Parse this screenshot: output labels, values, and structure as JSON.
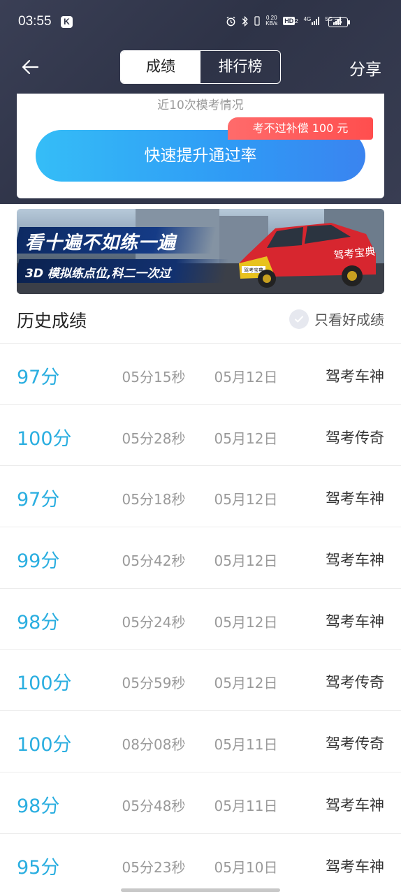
{
  "statusbar": {
    "time": "03:55",
    "k_badge": "K",
    "net_speed_value": "0.20",
    "net_speed_unit": "KB/s",
    "hd_label": "HD",
    "hd_sub": "2",
    "net1": "4G",
    "net2": "5G",
    "battery": "35"
  },
  "nav": {
    "tab_active": "成绩",
    "tab_inactive": "排行榜",
    "share_label": "分享"
  },
  "card": {
    "subtitle": "近10次模考情况",
    "cta_label": "快速提升通过率",
    "promo_label": "考不过补偿 100 元"
  },
  "banner": {
    "headline": "看十遍不如练一遍",
    "subline": "3D 模拟练点位,科二一次过",
    "car_text": "驾考宝典",
    "plate_text": "驾考宝典"
  },
  "history": {
    "title": "历史成绩",
    "filter_label": "只看好成绩",
    "rows": [
      {
        "score": "97分",
        "duration": "05分15秒",
        "date": "05月12日",
        "rank": "驾考车神"
      },
      {
        "score": "100分",
        "duration": "05分28秒",
        "date": "05月12日",
        "rank": "驾考传奇"
      },
      {
        "score": "97分",
        "duration": "05分18秒",
        "date": "05月12日",
        "rank": "驾考车神"
      },
      {
        "score": "99分",
        "duration": "05分42秒",
        "date": "05月12日",
        "rank": "驾考车神"
      },
      {
        "score": "98分",
        "duration": "05分24秒",
        "date": "05月12日",
        "rank": "驾考车神"
      },
      {
        "score": "100分",
        "duration": "05分59秒",
        "date": "05月12日",
        "rank": "驾考传奇"
      },
      {
        "score": "100分",
        "duration": "08分08秒",
        "date": "05月11日",
        "rank": "驾考传奇"
      },
      {
        "score": "98分",
        "duration": "05分48秒",
        "date": "05月11日",
        "rank": "驾考车神"
      },
      {
        "score": "95分",
        "duration": "05分23秒",
        "date": "05月10日",
        "rank": "驾考车神"
      }
    ]
  },
  "colors": {
    "header_bg": "#2e3347",
    "score_blue": "#2aaee0",
    "cta_start": "#35bdf7",
    "cta_end": "#3a84f0",
    "promo_red": "#ff5252"
  }
}
